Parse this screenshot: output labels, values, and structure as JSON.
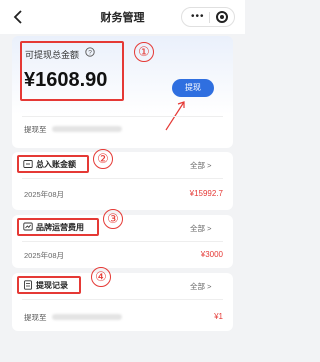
{
  "nav": {
    "title": "财务管理",
    "more_glyph": "•••"
  },
  "top_card": {
    "balance_label": "可提现总金额",
    "balance_value": "¥1608.90",
    "withdraw_button": "提现",
    "withdraw_to_label": "提现至"
  },
  "total_account": {
    "title": "总入账金额",
    "all_label": "全部 >",
    "date": "2025年08月",
    "amount": "¥15992.7"
  },
  "brand_fee": {
    "title": "品牌运营费用",
    "all_label": "全部 >",
    "date": "2025年08月",
    "amount": "¥3000"
  },
  "withdraw_record": {
    "title": "提现记录",
    "all_label": "全部 >",
    "row_label": "提现至",
    "amount": "¥1"
  },
  "annotations": [
    "①",
    "②",
    "③",
    "④"
  ],
  "colors": {
    "accent_blue": "#2f6fe0",
    "annotation_red": "#e53935",
    "amount_red": "#e53935"
  },
  "icons": {
    "back": "back-arrow-icon",
    "help": "question-circle-icon",
    "total": "wallet-icon",
    "brand": "chart-icon",
    "record": "document-icon"
  }
}
